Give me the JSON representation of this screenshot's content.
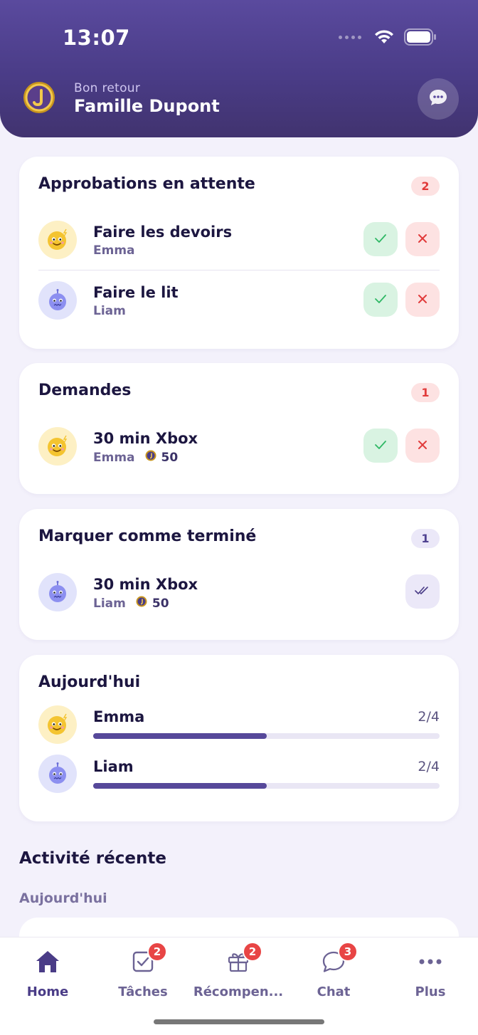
{
  "status_bar": {
    "time": "13:07"
  },
  "header": {
    "greeting": "Bon retour",
    "family_name": "Famille Dupont"
  },
  "pending_approvals": {
    "title": "Approbations en attente",
    "count": "2",
    "items": [
      {
        "task": "Faire les devoirs",
        "child": "Emma"
      },
      {
        "task": "Faire le lit",
        "child": "Liam"
      }
    ]
  },
  "requests": {
    "title": "Demandes",
    "count": "1",
    "items": [
      {
        "reward": "30 min Xbox",
        "child": "Emma",
        "points": "50"
      }
    ]
  },
  "mark_done": {
    "title": "Marquer comme terminé",
    "count": "1",
    "items": [
      {
        "reward": "30 min Xbox",
        "child": "Liam",
        "points": "50"
      }
    ]
  },
  "today": {
    "title": "Aujourd'hui",
    "children": [
      {
        "name": "Emma",
        "progress_text": "2/4",
        "progress": 0.5
      },
      {
        "name": "Liam",
        "progress_text": "2/4",
        "progress": 0.5
      }
    ]
  },
  "recent_activity": {
    "title": "Activité récente",
    "group_label": "Aujourd'hui"
  },
  "tabbar": {
    "tabs": [
      {
        "label": "Home",
        "icon": "home-icon",
        "badge": ""
      },
      {
        "label": "Tâches",
        "icon": "tasks-icon",
        "badge": "2"
      },
      {
        "label": "Récompen...",
        "icon": "gift-icon",
        "badge": "2"
      },
      {
        "label": "Chat",
        "icon": "chat-icon",
        "badge": "3"
      },
      {
        "label": "Plus",
        "icon": "more-icon",
        "badge": ""
      }
    ]
  },
  "colors": {
    "header": "#4a3c87",
    "accent": "#56489a",
    "approve": "#2fb865",
    "reject": "#e13b3b",
    "badge": "#e84545"
  }
}
